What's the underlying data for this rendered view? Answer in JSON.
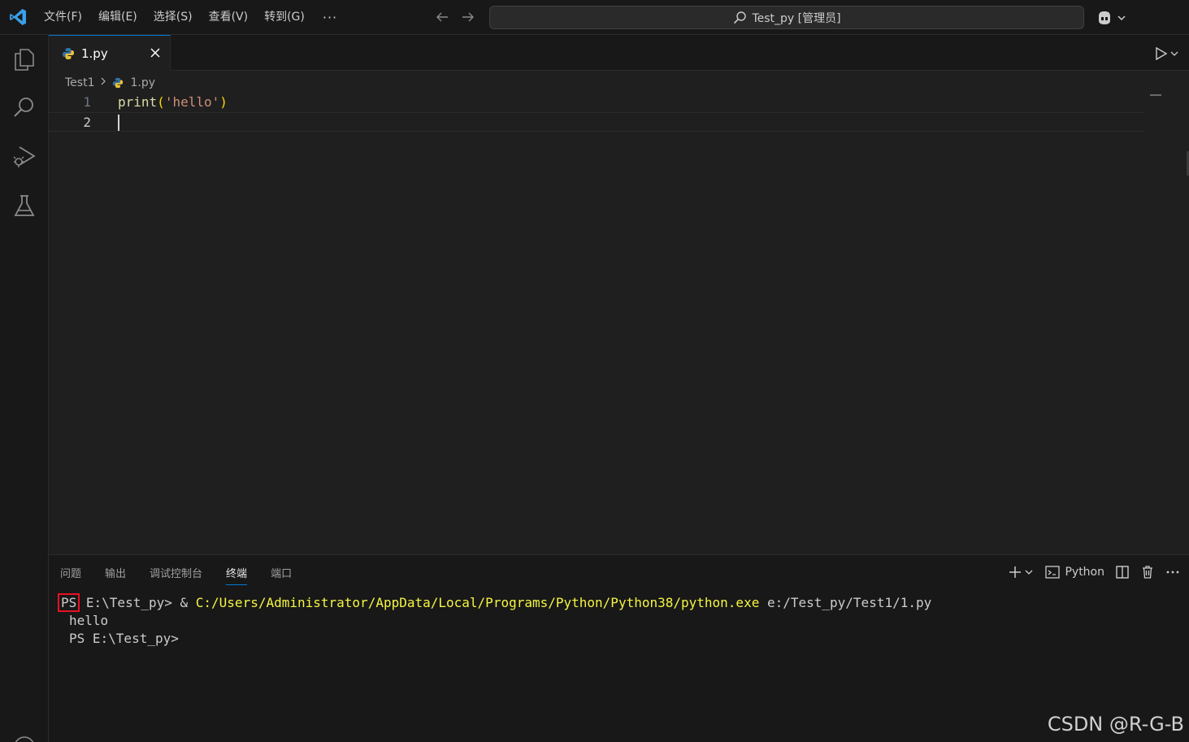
{
  "titlebar": {
    "menu": [
      "文件(F)",
      "编辑(E)",
      "选择(S)",
      "查看(V)",
      "转到(G)"
    ],
    "more": "···",
    "command_center": "Test_py [管理员]"
  },
  "tab": {
    "label": "1.py"
  },
  "breadcrumb": {
    "folder": "Test1",
    "file": "1.py"
  },
  "editor": {
    "lines": [
      {
        "num": "1",
        "fn": "print",
        "open": "(",
        "str": "'hello'",
        "close": ")"
      },
      {
        "num": "2"
      }
    ]
  },
  "panel": {
    "tabs": [
      "问题",
      "输出",
      "调试控制台",
      "终端",
      "端口"
    ],
    "active_tab": "终端",
    "shell": "Python",
    "terminal": {
      "ps": "PS",
      "prompt1_rest": " E:\\Test_py> & ",
      "exe": "C:/Users/Administrator/AppData/Local/Programs/Python/Python38/python.exe",
      "arg": " e:/Test_py/Test1/1.py",
      "output": "hello",
      "prompt2": "PS E:\\Test_py>"
    }
  },
  "watermark": "CSDN @R-G-B",
  "colors": {
    "accent": "#0078d4",
    "highlight_box": "#e81123"
  }
}
